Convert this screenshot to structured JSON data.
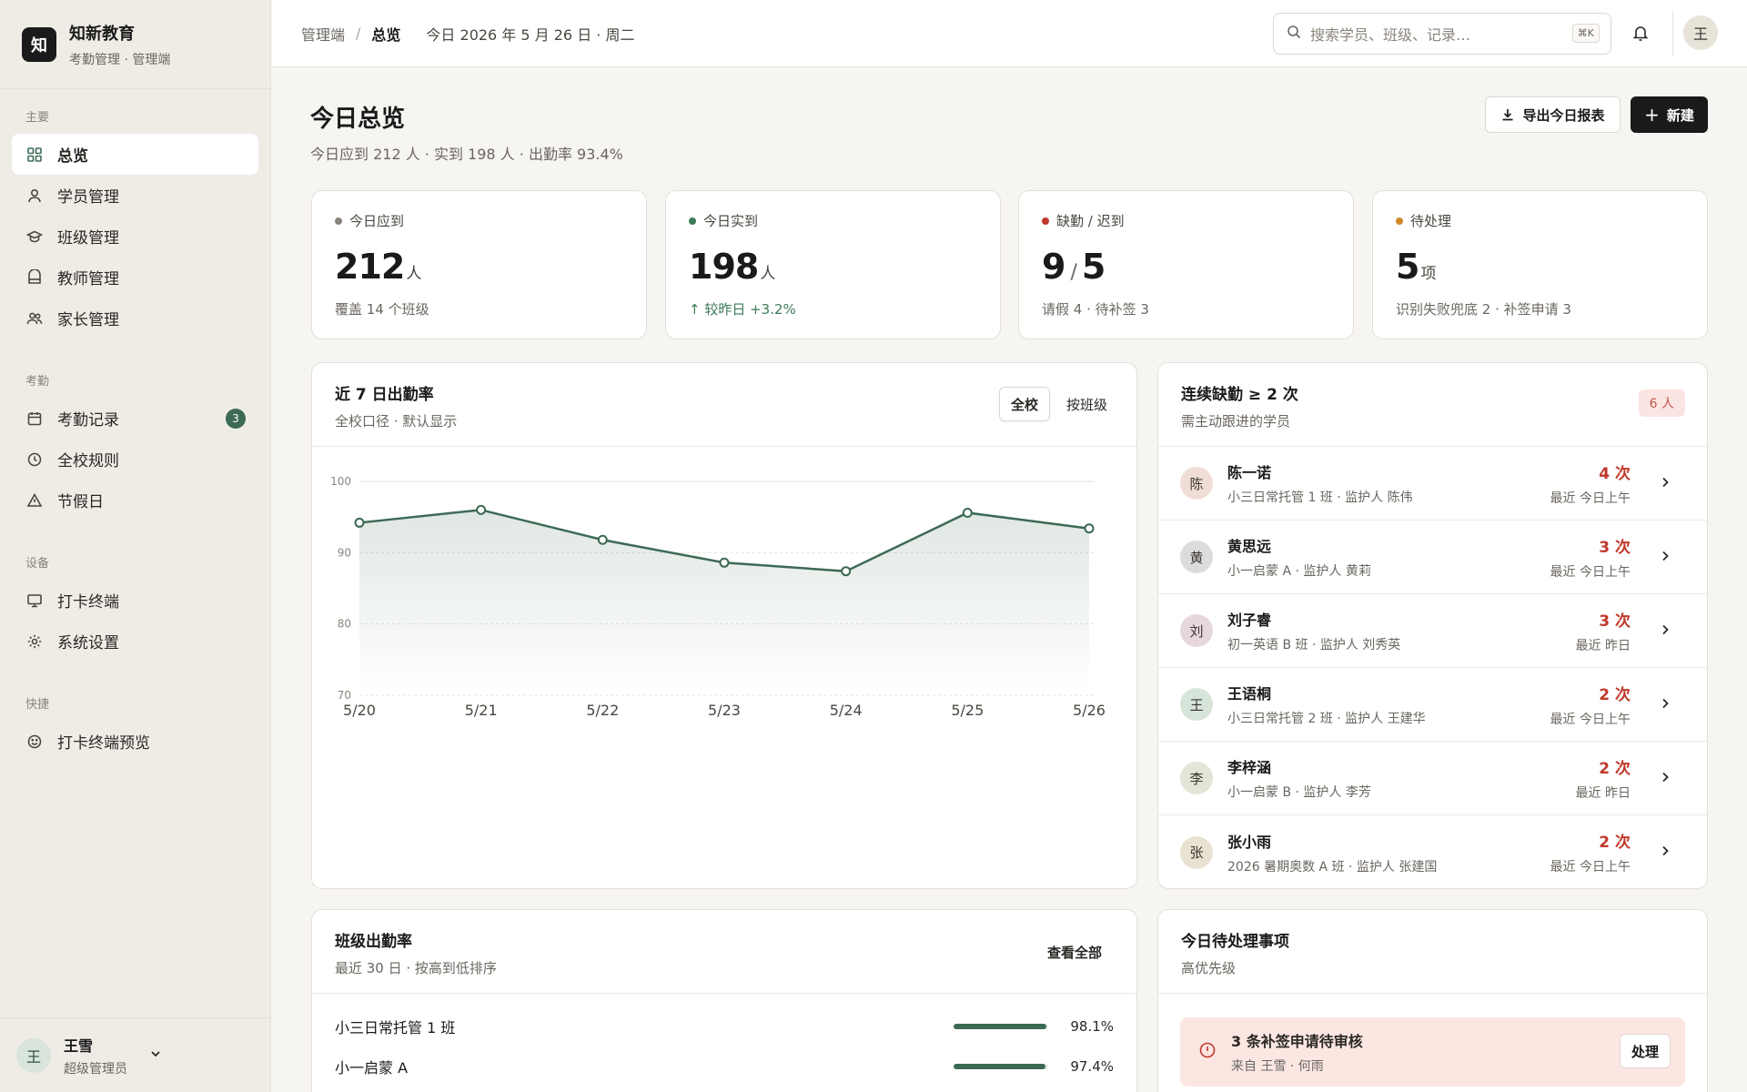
{
  "brand": {
    "logo_char": "知",
    "name": "知新教育",
    "sub": "考勤管理 · 管理端"
  },
  "sidebar": {
    "sections": [
      {
        "title": "主要",
        "items": [
          {
            "label": "总览",
            "icon": "grid-icon",
            "active": true
          },
          {
            "label": "学员管理",
            "icon": "user-icon"
          },
          {
            "label": "班级管理",
            "icon": "graduation-cap-icon"
          },
          {
            "label": "教师管理",
            "icon": "id-badge-icon"
          },
          {
            "label": "家长管理",
            "icon": "users-icon"
          }
        ]
      },
      {
        "title": "考勤",
        "items": [
          {
            "label": "考勤记录",
            "icon": "calendar-icon",
            "badge": "3"
          },
          {
            "label": "全校规则",
            "icon": "clock-icon"
          },
          {
            "label": "节假日",
            "icon": "triangle-icon"
          }
        ]
      },
      {
        "title": "设备",
        "items": [
          {
            "label": "打卡终端",
            "icon": "monitor-icon"
          },
          {
            "label": "系统设置",
            "icon": "settings-icon"
          }
        ]
      },
      {
        "title": "快捷",
        "items": [
          {
            "label": "打卡终端预览",
            "icon": "smile-icon"
          }
        ]
      }
    ],
    "user": {
      "avatar": "王",
      "name": "王雪",
      "role": "超级管理员"
    }
  },
  "header": {
    "crumb_root": "管理端",
    "crumb_sep": "/",
    "crumb_current": "总览",
    "date": "今日 2026 年 5 月 26 日 · 周二",
    "search_placeholder": "搜索学员、班级、记录…",
    "search_kbd": "⌘K",
    "avatar": "王"
  },
  "page": {
    "title": "今日总览",
    "subtitle": "今日应到 212 人 · 实到 198 人 · 出勤率 93.4%",
    "export_label": "导出今日报表",
    "new_label": "新建"
  },
  "stats": [
    {
      "label": "今日应到",
      "dot": "#8a857c",
      "value": "212",
      "unit": "人",
      "note": "覆盖 14 个班级"
    },
    {
      "label": "今日实到",
      "dot": "#3d7a5a",
      "value": "198",
      "unit": "人",
      "note": "较昨日 +3.2%",
      "note_up": true
    },
    {
      "label": "缺勤 / 迟到",
      "dot": "#c0392b",
      "value_a": "9",
      "slash": "/",
      "value_b": "5",
      "note": "请假 4 · 待补签 3"
    },
    {
      "label": "待处理",
      "dot": "#d08a2c",
      "value": "5",
      "unit": "项",
      "note": "识别失败兜底 2 · 补签申请 3"
    }
  ],
  "trend": {
    "title": "近 7 日出勤率",
    "subtitle": "全校口径 · 默认显示",
    "tabs": [
      "全校",
      "按班级"
    ],
    "active_tab": 0
  },
  "chart_data": {
    "type": "area",
    "x": [
      "5/20",
      "5/21",
      "5/22",
      "5/23",
      "5/24",
      "5/25",
      "5/26"
    ],
    "series": [
      {
        "values": [
          94.2,
          96.0,
          91.8,
          88.6,
          87.4,
          95.6,
          93.4
        ]
      }
    ],
    "ylim": [
      70,
      100
    ],
    "yticks": [
      100,
      90,
      80,
      70
    ],
    "grid": true,
    "color": "#3d6a54"
  },
  "absent": {
    "title": "连续缺勤 ≥ 2 次",
    "subtitle": "需主动跟进的学员",
    "count": "6 人",
    "rows": [
      {
        "avatar": "陈",
        "bg": "#f0ddd6",
        "name": "陈一诺",
        "meta": "小三日常托管 1 班 · 监护人 陈伟",
        "count": "4 次",
        "recent": "最近 今日上午"
      },
      {
        "avatar": "黄",
        "bg": "#dcdcdc",
        "name": "黄思远",
        "meta": "小一启蒙 A · 监护人 黄莉",
        "count": "3 次",
        "recent": "最近 今日上午"
      },
      {
        "avatar": "刘",
        "bg": "#e6d6de",
        "name": "刘子睿",
        "meta": "初一英语 B 班 · 监护人 刘秀英",
        "count": "3 次",
        "recent": "最近 昨日"
      },
      {
        "avatar": "王",
        "bg": "#d6e4da",
        "name": "王语桐",
        "meta": "小三日常托管 2 班 · 监护人 王建华",
        "count": "2 次",
        "recent": "最近 今日上午"
      },
      {
        "avatar": "李",
        "bg": "#e2e6d6",
        "name": "李梓涵",
        "meta": "小一启蒙 B · 监护人 李芳",
        "count": "2 次",
        "recent": "最近 昨日"
      },
      {
        "avatar": "张",
        "bg": "#e8e2d2",
        "name": "张小雨",
        "meta": "2026 暑期奥数 A 班 · 监护人 张建国",
        "count": "2 次",
        "recent": "最近 今日上午"
      }
    ]
  },
  "classes": {
    "title": "班级出勤率",
    "subtitle": "最近 30 日 · 按高到低排序",
    "link": "查看全部",
    "rows": [
      {
        "name": "小三日常托管 1 班",
        "pct": "98.1%",
        "value": 0.981
      },
      {
        "name": "小一启蒙 A",
        "pct": "97.4%",
        "value": 0.974
      }
    ]
  },
  "todo": {
    "title": "今日待处理事项",
    "subtitle": "高优先级",
    "item_title": "3 条补签申请待审核",
    "item_sub": "来自 王雪 · 何雨",
    "item_button": "处理"
  }
}
